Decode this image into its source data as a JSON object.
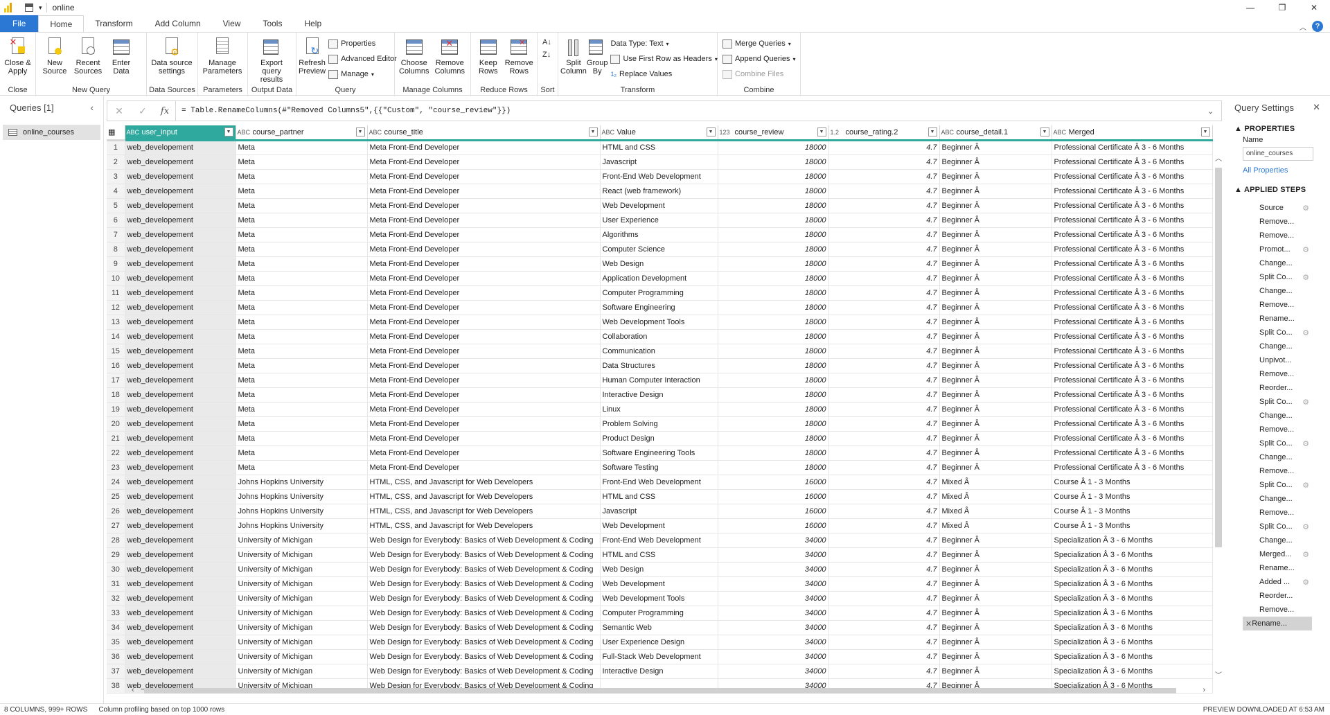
{
  "window": {
    "title": "online"
  },
  "tabs": [
    "File",
    "Home",
    "Transform",
    "Add Column",
    "View",
    "Tools",
    "Help"
  ],
  "ribbon": {
    "close": {
      "btn": "Close & Apply",
      "group": "Close"
    },
    "newquery": {
      "new_source": "New Source",
      "recent_sources": "Recent Sources",
      "enter_data": "Enter Data",
      "group": "New Query"
    },
    "datasources": {
      "btn": "Data source settings",
      "group": "Data Sources"
    },
    "parameters": {
      "btn": "Manage Parameters",
      "group": "Parameters"
    },
    "outputdata": {
      "btn": "Export query results",
      "group": "Output Data"
    },
    "query": {
      "refresh": "Refresh Preview",
      "properties": "Properties",
      "advanced": "Advanced Editor",
      "manage": "Manage",
      "group": "Query"
    },
    "managecols": {
      "choose": "Choose Columns",
      "remove": "Remove Columns",
      "group": "Manage Columns"
    },
    "reducerows": {
      "keep": "Keep Rows",
      "remove": "Remove Rows",
      "group": "Reduce Rows"
    },
    "sort": {
      "group": "Sort"
    },
    "transform": {
      "split": "Split Column",
      "groupby": "Group By",
      "datatype": "Data Type: Text",
      "firstrow": "Use First Row as Headers",
      "replace": "Replace Values",
      "group": "Transform"
    },
    "combine": {
      "merge": "Merge Queries",
      "append": "Append Queries",
      "combine_files": "Combine Files",
      "group": "Combine"
    }
  },
  "queries": {
    "header": "Queries [1]",
    "items": [
      "online_courses"
    ]
  },
  "formula": "= Table.RenameColumns(#\"Removed Columns5\",{{\"Custom\", \"course_review\"}})",
  "columns": [
    {
      "name": "user_input",
      "type": "ABC",
      "width": 160
    },
    {
      "name": "course_partner",
      "type": "ABC",
      "width": 190
    },
    {
      "name": "course_title",
      "type": "ABC",
      "width": 336
    },
    {
      "name": "Value",
      "type": "ABC",
      "width": 170
    },
    {
      "name": "course_review",
      "type": "123",
      "width": 160
    },
    {
      "name": "course_rating.2",
      "type": "1.2",
      "width": 160
    },
    {
      "name": "course_detail.1",
      "type": "ABC",
      "width": 162
    },
    {
      "name": "Merged",
      "type": "ABC",
      "width": 232
    }
  ],
  "rows": [
    [
      "web_developement",
      "Meta",
      "Meta Front-End Developer",
      "HTML and CSS",
      "18000",
      "4.7",
      "Beginner Â",
      "Professional Certificate Â 3 - 6 Months"
    ],
    [
      "web_developement",
      "Meta",
      "Meta Front-End Developer",
      "Javascript",
      "18000",
      "4.7",
      "Beginner Â",
      "Professional Certificate Â 3 - 6 Months"
    ],
    [
      "web_developement",
      "Meta",
      "Meta Front-End Developer",
      "Front-End Web Development",
      "18000",
      "4.7",
      "Beginner Â",
      "Professional Certificate Â 3 - 6 Months"
    ],
    [
      "web_developement",
      "Meta",
      "Meta Front-End Developer",
      "React (web framework)",
      "18000",
      "4.7",
      "Beginner Â",
      "Professional Certificate Â 3 - 6 Months"
    ],
    [
      "web_developement",
      "Meta",
      "Meta Front-End Developer",
      "Web Development",
      "18000",
      "4.7",
      "Beginner Â",
      "Professional Certificate Â 3 - 6 Months"
    ],
    [
      "web_developement",
      "Meta",
      "Meta Front-End Developer",
      "User Experience",
      "18000",
      "4.7",
      "Beginner Â",
      "Professional Certificate Â 3 - 6 Months"
    ],
    [
      "web_developement",
      "Meta",
      "Meta Front-End Developer",
      "Algorithms",
      "18000",
      "4.7",
      "Beginner Â",
      "Professional Certificate Â 3 - 6 Months"
    ],
    [
      "web_developement",
      "Meta",
      "Meta Front-End Developer",
      "Computer Science",
      "18000",
      "4.7",
      "Beginner Â",
      "Professional Certificate Â 3 - 6 Months"
    ],
    [
      "web_developement",
      "Meta",
      "Meta Front-End Developer",
      "Web Design",
      "18000",
      "4.7",
      "Beginner Â",
      "Professional Certificate Â 3 - 6 Months"
    ],
    [
      "web_developement",
      "Meta",
      "Meta Front-End Developer",
      "Application Development",
      "18000",
      "4.7",
      "Beginner Â",
      "Professional Certificate Â 3 - 6 Months"
    ],
    [
      "web_developement",
      "Meta",
      "Meta Front-End Developer",
      "Computer Programming",
      "18000",
      "4.7",
      "Beginner Â",
      "Professional Certificate Â 3 - 6 Months"
    ],
    [
      "web_developement",
      "Meta",
      "Meta Front-End Developer",
      "Software Engineering",
      "18000",
      "4.7",
      "Beginner Â",
      "Professional Certificate Â 3 - 6 Months"
    ],
    [
      "web_developement",
      "Meta",
      "Meta Front-End Developer",
      "Web Development Tools",
      "18000",
      "4.7",
      "Beginner Â",
      "Professional Certificate Â 3 - 6 Months"
    ],
    [
      "web_developement",
      "Meta",
      "Meta Front-End Developer",
      "Collaboration",
      "18000",
      "4.7",
      "Beginner Â",
      "Professional Certificate Â 3 - 6 Months"
    ],
    [
      "web_developement",
      "Meta",
      "Meta Front-End Developer",
      "Communication",
      "18000",
      "4.7",
      "Beginner Â",
      "Professional Certificate Â 3 - 6 Months"
    ],
    [
      "web_developement",
      "Meta",
      "Meta Front-End Developer",
      "Data Structures",
      "18000",
      "4.7",
      "Beginner Â",
      "Professional Certificate Â 3 - 6 Months"
    ],
    [
      "web_developement",
      "Meta",
      "Meta Front-End Developer",
      "Human Computer Interaction",
      "18000",
      "4.7",
      "Beginner Â",
      "Professional Certificate Â 3 - 6 Months"
    ],
    [
      "web_developement",
      "Meta",
      "Meta Front-End Developer",
      "Interactive Design",
      "18000",
      "4.7",
      "Beginner Â",
      "Professional Certificate Â 3 - 6 Months"
    ],
    [
      "web_developement",
      "Meta",
      "Meta Front-End Developer",
      "Linux",
      "18000",
      "4.7",
      "Beginner Â",
      "Professional Certificate Â 3 - 6 Months"
    ],
    [
      "web_developement",
      "Meta",
      "Meta Front-End Developer",
      "Problem Solving",
      "18000",
      "4.7",
      "Beginner Â",
      "Professional Certificate Â 3 - 6 Months"
    ],
    [
      "web_developement",
      "Meta",
      "Meta Front-End Developer",
      "Product Design",
      "18000",
      "4.7",
      "Beginner Â",
      "Professional Certificate Â 3 - 6 Months"
    ],
    [
      "web_developement",
      "Meta",
      "Meta Front-End Developer",
      "Software Engineering Tools",
      "18000",
      "4.7",
      "Beginner Â",
      "Professional Certificate Â 3 - 6 Months"
    ],
    [
      "web_developement",
      "Meta",
      "Meta Front-End Developer",
      "Software Testing",
      "18000",
      "4.7",
      "Beginner Â",
      "Professional Certificate Â 3 - 6 Months"
    ],
    [
      "web_developement",
      "Johns Hopkins University",
      "HTML, CSS, and Javascript for Web Developers",
      "Front-End Web Development",
      "16000",
      "4.7",
      "Mixed Â",
      "Course Â 1 - 3 Months"
    ],
    [
      "web_developement",
      "Johns Hopkins University",
      "HTML, CSS, and Javascript for Web Developers",
      "HTML and CSS",
      "16000",
      "4.7",
      "Mixed Â",
      "Course Â 1 - 3 Months"
    ],
    [
      "web_developement",
      "Johns Hopkins University",
      "HTML, CSS, and Javascript for Web Developers",
      "Javascript",
      "16000",
      "4.7",
      "Mixed Â",
      "Course Â 1 - 3 Months"
    ],
    [
      "web_developement",
      "Johns Hopkins University",
      "HTML, CSS, and Javascript for Web Developers",
      "Web Development",
      "16000",
      "4.7",
      "Mixed Â",
      "Course Â 1 - 3 Months"
    ],
    [
      "web_developement",
      "University of Michigan",
      "Web Design for Everybody: Basics of Web Development & Coding",
      "Front-End Web Development",
      "34000",
      "4.7",
      "Beginner Â",
      "Specialization Â 3 - 6 Months"
    ],
    [
      "web_developement",
      "University of Michigan",
      "Web Design for Everybody: Basics of Web Development & Coding",
      "HTML and CSS",
      "34000",
      "4.7",
      "Beginner Â",
      "Specialization Â 3 - 6 Months"
    ],
    [
      "web_developement",
      "University of Michigan",
      "Web Design for Everybody: Basics of Web Development & Coding",
      "Web Design",
      "34000",
      "4.7",
      "Beginner Â",
      "Specialization Â 3 - 6 Months"
    ],
    [
      "web_developement",
      "University of Michigan",
      "Web Design for Everybody: Basics of Web Development & Coding",
      "Web Development",
      "34000",
      "4.7",
      "Beginner Â",
      "Specialization Â 3 - 6 Months"
    ],
    [
      "web_developement",
      "University of Michigan",
      "Web Design for Everybody: Basics of Web Development & Coding",
      "Web Development Tools",
      "34000",
      "4.7",
      "Beginner Â",
      "Specialization Â 3 - 6 Months"
    ],
    [
      "web_developement",
      "University of Michigan",
      "Web Design for Everybody: Basics of Web Development & Coding",
      "Computer Programming",
      "34000",
      "4.7",
      "Beginner Â",
      "Specialization Â 3 - 6 Months"
    ],
    [
      "web_developement",
      "University of Michigan",
      "Web Design for Everybody: Basics of Web Development & Coding",
      "Semantic Web",
      "34000",
      "4.7",
      "Beginner Â",
      "Specialization Â 3 - 6 Months"
    ],
    [
      "web_developement",
      "University of Michigan",
      "Web Design for Everybody: Basics of Web Development & Coding",
      "User Experience Design",
      "34000",
      "4.7",
      "Beginner Â",
      "Specialization Â 3 - 6 Months"
    ],
    [
      "web_developement",
      "University of Michigan",
      "Web Design for Everybody: Basics of Web Development & Coding",
      "Full-Stack Web Development",
      "34000",
      "4.7",
      "Beginner Â",
      "Specialization Â 3 - 6 Months"
    ],
    [
      "web_developement",
      "University of Michigan",
      "Web Design for Everybody: Basics of Web Development & Coding",
      "Interactive Design",
      "34000",
      "4.7",
      "Beginner Â",
      "Specialization Â 3 - 6 Months"
    ],
    [
      "web_developement",
      "University of Michigan",
      "Web Design for Everybody: Basics of Web Development & Coding",
      "",
      "34000",
      "4.7",
      "Beginner Â",
      "Specialization Â 3 - 6 Months"
    ]
  ],
  "settings": {
    "header": "Query Settings",
    "properties": "PROPERTIES",
    "name_label": "Name",
    "name_value": "online_courses",
    "all_properties": "All Properties",
    "applied_steps": "APPLIED STEPS",
    "steps": [
      {
        "label": "Source",
        "gear": true
      },
      {
        "label": "Remove...",
        "gear": false
      },
      {
        "label": "Remove...",
        "gear": false
      },
      {
        "label": "Promot...",
        "gear": true
      },
      {
        "label": "Change...",
        "gear": false
      },
      {
        "label": "Split Co...",
        "gear": true
      },
      {
        "label": "Change...",
        "gear": false
      },
      {
        "label": "Remove...",
        "gear": false
      },
      {
        "label": "Rename...",
        "gear": false
      },
      {
        "label": "Split Co...",
        "gear": true
      },
      {
        "label": "Change...",
        "gear": false
      },
      {
        "label": "Unpivot...",
        "gear": false
      },
      {
        "label": "Remove...",
        "gear": false
      },
      {
        "label": "Reorder...",
        "gear": false
      },
      {
        "label": "Split Co...",
        "gear": true
      },
      {
        "label": "Change...",
        "gear": false
      },
      {
        "label": "Remove...",
        "gear": false
      },
      {
        "label": "Split Co...",
        "gear": true
      },
      {
        "label": "Change...",
        "gear": false
      },
      {
        "label": "Remove...",
        "gear": false
      },
      {
        "label": "Split Co...",
        "gear": true
      },
      {
        "label": "Change...",
        "gear": false
      },
      {
        "label": "Remove...",
        "gear": false
      },
      {
        "label": "Split Co...",
        "gear": true
      },
      {
        "label": "Change...",
        "gear": false
      },
      {
        "label": "Merged...",
        "gear": true
      },
      {
        "label": "Rename...",
        "gear": false
      },
      {
        "label": "Added ...",
        "gear": true
      },
      {
        "label": "Reorder...",
        "gear": false
      },
      {
        "label": "Remove...",
        "gear": false
      },
      {
        "label": "Rename...",
        "gear": false,
        "active": true
      }
    ]
  },
  "status": {
    "left": "8 COLUMNS, 999+ ROWS",
    "profiling": "Column profiling based on top 1000 rows",
    "right": "PREVIEW DOWNLOADED AT 6:53 AM"
  },
  "colors": {
    "accent": "#2fa89e",
    "file_tab": "#2b78d4",
    "link": "#2b78d4"
  }
}
